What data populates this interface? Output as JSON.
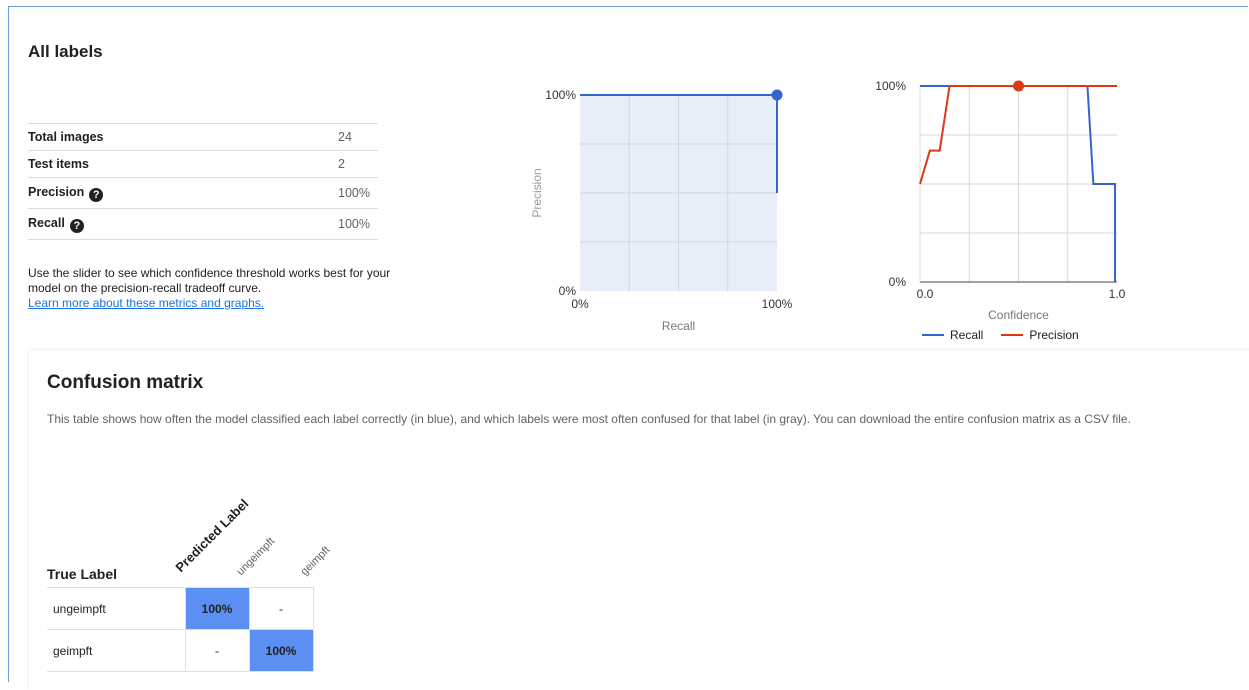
{
  "section": {
    "title": "All labels"
  },
  "stats": [
    {
      "label": "Total images",
      "value": "24",
      "help": false
    },
    {
      "label": "Test items",
      "value": "2",
      "help": false
    },
    {
      "label": "Precision",
      "value": "100%",
      "help": true
    },
    {
      "label": "Recall",
      "value": "100%",
      "help": true
    }
  ],
  "help_glyph": "?",
  "description": {
    "line1": "Use the slider to see which confidence threshold works best for your",
    "line2": "model on the precision-recall tradeoff curve.",
    "link": "Learn more about these metrics and graphs."
  },
  "colors": {
    "recall": "#3366cc",
    "precision": "#dc3912",
    "highlight": "#5b8ff2"
  },
  "chart_data": [
    {
      "type": "area",
      "xlabel": "Recall",
      "ylabel": "Precision",
      "x_ticks": [
        "0%",
        "100%"
      ],
      "y_ticks": [
        "0%",
        "100%"
      ],
      "xlim": [
        0,
        1
      ],
      "ylim": [
        0,
        1
      ],
      "grid": true,
      "series": [
        {
          "x": [
            0,
            1,
            1
          ],
          "y": [
            1,
            1,
            0.5
          ]
        }
      ],
      "marker": {
        "x": 1,
        "y": 1
      }
    },
    {
      "type": "line",
      "xlabel": "Confidence",
      "x_ticks": [
        "0.0",
        "1.0"
      ],
      "y_ticks": [
        "0%",
        "100%"
      ],
      "xlim": [
        0,
        1
      ],
      "ylim": [
        0,
        1
      ],
      "grid": true,
      "legend_position": "bottom",
      "series": [
        {
          "name": "Recall",
          "x": [
            0,
            0.85,
            0.88,
            0.99,
            0.99
          ],
          "y": [
            1,
            1,
            0.5,
            0.5,
            0
          ]
        },
        {
          "name": "Precision",
          "x": [
            0,
            0.05,
            0.1,
            0.15,
            1
          ],
          "y": [
            0.5,
            0.67,
            0.67,
            1,
            1
          ]
        }
      ],
      "marker": {
        "x": 0.5,
        "y": 1
      }
    }
  ],
  "confusion_matrix": {
    "title": "Confusion matrix",
    "description": "This table shows how often the model classified each label correctly (in blue), and which labels were most often confused for that label (in gray). You can download the entire confusion matrix as a CSV file.",
    "predicted_header": "Predicted Label",
    "true_header": "True Label",
    "columns": [
      "ungeimpft",
      "geimpft"
    ],
    "rows": [
      {
        "label": "ungeimpft",
        "cells": [
          "100%",
          "-"
        ]
      },
      {
        "label": "geimpft",
        "cells": [
          "-",
          "100%"
        ]
      }
    ]
  }
}
